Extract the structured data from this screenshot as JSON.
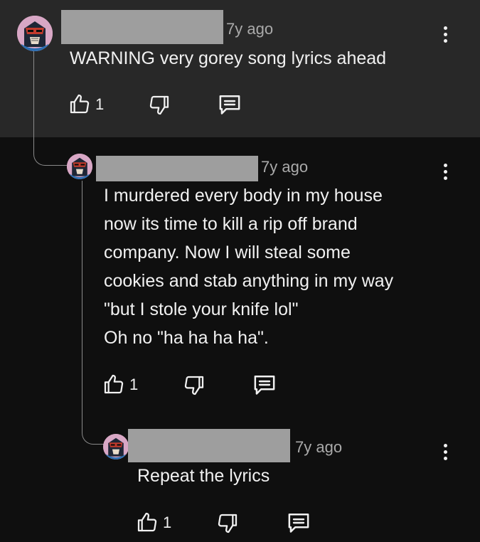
{
  "comments": [
    {
      "time": "7y ago",
      "text": "WARNING very gorey song lyrics ahead",
      "likes": "1"
    },
    {
      "time": "7y ago",
      "text": "I murdered every body in my house\nnow its time to kill a rip off brand\ncompany. Now I will steal some\ncookies and stab anything in my way\n\"but I stole your knife lol\"\nOh no \"ha ha ha ha\".",
      "likes": "1"
    },
    {
      "time": "7y ago",
      "text": "Repeat the lyrics",
      "likes": "1"
    }
  ],
  "icons": {
    "like": "thumbs-up-icon",
    "dislike": "thumbs-down-icon",
    "reply": "reply-comment-icon",
    "menu": "more-vertical-icon"
  },
  "colors": {
    "background": "#0f0f0f",
    "highlighted_comment_bg": "#282828",
    "text": "#f1f1f1",
    "secondary_text": "#aaaaaa",
    "redaction": "#9e9e9e"
  }
}
